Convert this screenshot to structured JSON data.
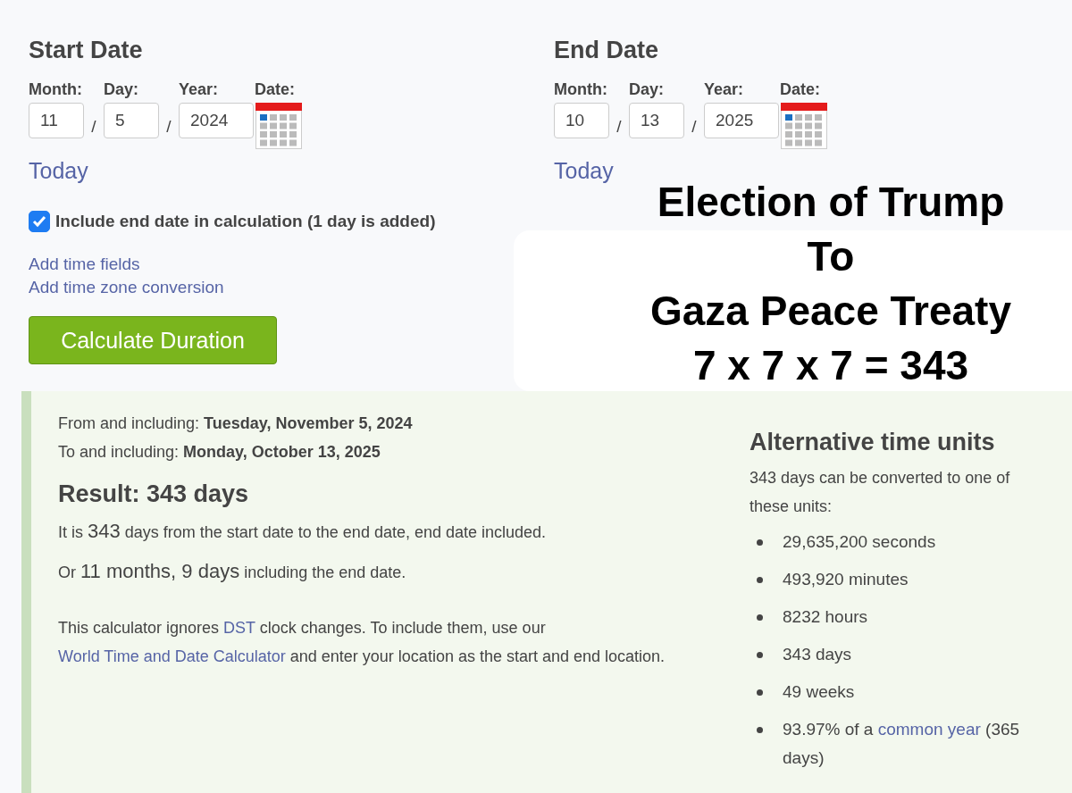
{
  "date_groups": [
    {
      "heading": "Start Date",
      "labels": [
        "Month:",
        "Day:",
        "Year:",
        "Date:"
      ],
      "month": "11",
      "day": "5",
      "year": "2024",
      "separators": [
        "/",
        "/"
      ],
      "today": "Today"
    },
    {
      "heading": "End Date",
      "labels": [
        "Month:",
        "Day:",
        "Year:",
        "Date:"
      ],
      "month": "10",
      "day": "13",
      "year": "2025",
      "separators": [
        "/",
        "/"
      ],
      "today": "Today"
    }
  ],
  "include_end": {
    "label": "Include end date in calculation (1 day is added)",
    "checked": true
  },
  "links": [
    "Add time fields",
    "Add time zone conversion"
  ],
  "button": "Calculate Duration",
  "overlay_lines": [
    "Election of Trump",
    "To",
    "Gaza Peace Treaty",
    "7 x 7 x 7 = 343"
  ],
  "result": {
    "range": [
      {
        "label": "From and including:",
        "value": "Tuesday, November 5, 2024"
      },
      {
        "label": "To and including:",
        "value": "Monday, October 13, 2025"
      }
    ],
    "heading": "Result: 343 days",
    "paragraphs": [
      [
        {
          "kind": "text",
          "text": "It is "
        },
        {
          "kind": "big",
          "text": "343"
        },
        {
          "kind": "text",
          "text": " days from the start date to the end date, end date included."
        }
      ],
      [
        {
          "kind": "text",
          "text": "Or "
        },
        {
          "kind": "big",
          "text": "11 months, 9 days"
        },
        {
          "kind": "text",
          "text": " including the end date."
        }
      ],
      [
        {
          "kind": "text",
          "text": "This calculator ignores "
        },
        {
          "kind": "link",
          "text": "DST"
        },
        {
          "kind": "text",
          "text": " clock changes. To include them, use our "
        },
        {
          "kind": "link",
          "text": "World Time and Date Calculator"
        },
        {
          "kind": "text",
          "text": " and enter your location as the start and end location."
        }
      ]
    ]
  },
  "alt_units": {
    "heading": "Alternative time units",
    "intro": "343 days can be converted to one of these units:",
    "items": [
      [
        {
          "kind": "text",
          "text": "29,635,200 seconds"
        }
      ],
      [
        {
          "kind": "text",
          "text": "493,920 minutes"
        }
      ],
      [
        {
          "kind": "text",
          "text": "8232 hours"
        }
      ],
      [
        {
          "kind": "text",
          "text": "343 days"
        }
      ],
      [
        {
          "kind": "text",
          "text": "49 weeks"
        }
      ],
      [
        {
          "kind": "text",
          "text": "93.97% of a "
        },
        {
          "kind": "link",
          "text": "common year"
        },
        {
          "kind": "text",
          "text": " (365 days)"
        }
      ]
    ]
  }
}
